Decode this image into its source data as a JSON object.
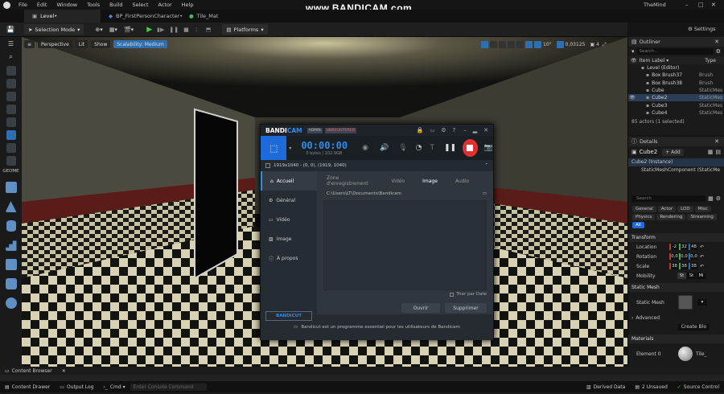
{
  "watermark": "www.BANDICAM.com",
  "menu": [
    "File",
    "Edit",
    "Window",
    "Tools",
    "Build",
    "Select",
    "Actor",
    "Help"
  ],
  "project_name": "TheMind",
  "tabs": [
    {
      "label": "Level•",
      "active": true
    },
    {
      "label": "BP_FirstPersonCharacter•",
      "active": false
    },
    {
      "label": "Tile_Mat",
      "active": false
    }
  ],
  "toolbar": {
    "selection_mode": "Selection Mode",
    "platforms": "Platforms",
    "settings": "Settings",
    "snap_angle": "10°",
    "snap_scale": "0,03125",
    "cam_speed": "4"
  },
  "viewport_bar": {
    "perspective": "Perspective",
    "lit": "Lit",
    "show": "Show",
    "scalability": "Scalability: Medium"
  },
  "left_panel": {
    "geometry_label": "GEOME"
  },
  "outliner": {
    "title": "Outliner",
    "search_placeholder": "Search...",
    "col_label": "Item Label ▾",
    "col_type": "Type",
    "rows": [
      {
        "label": "Level (Editor)",
        "type": "",
        "indent": 1,
        "selected": false
      },
      {
        "label": "Box Brush37",
        "type": "Brush",
        "indent": 2,
        "selected": false
      },
      {
        "label": "Box Brush38",
        "type": "Brush",
        "indent": 2,
        "selected": false
      },
      {
        "label": "Cube",
        "type": "StaticMes",
        "indent": 2,
        "selected": false
      },
      {
        "label": "Cube2",
        "type": "StaticMes",
        "indent": 2,
        "selected": true
      },
      {
        "label": "Cube3",
        "type": "StaticMes",
        "indent": 2,
        "selected": false
      },
      {
        "label": "Cube4",
        "type": "StaticMes",
        "indent": 2,
        "selected": false
      }
    ],
    "count": "85 actors (1 selected)"
  },
  "details": {
    "title": "Details",
    "actor_name": "Cube2",
    "add_label": "+ Add",
    "instance": "Cube2 (Instance)",
    "component": "StaticMeshComponent (StaticMe",
    "search_placeholder": "Search",
    "filters": [
      "General",
      "Actor",
      "LOD",
      "Misc",
      "Physics",
      "Rendering",
      "Streaming",
      "All"
    ],
    "transform_title": "Transform",
    "location_label": "Location",
    "location": [
      "-2",
      "32",
      "48"
    ],
    "rotation_label": "Rotation",
    "rotation": [
      "0,0",
      "0,0",
      "0,0"
    ],
    "scale_label": "Scale",
    "scale": [
      "38",
      "38",
      "38"
    ],
    "mobility_label": "Mobility",
    "mobility_opts": [
      "St",
      "St",
      "Mi"
    ],
    "static_mesh_title": "Static Mesh",
    "static_mesh_label": "Static Mesh",
    "advanced_label": "Advanced",
    "create_bp": "Create Blo",
    "materials_title": "Materials",
    "element_label": "Element 0",
    "material_name": "Tile_"
  },
  "bottom": {
    "content_browser_tab": "Content Browser",
    "content_drawer": "Content Drawer",
    "output_log": "Output Log",
    "cmd": "Cmd",
    "console_placeholder": "Enter Console Command",
    "derived_data": "Derived Data",
    "unsaved": "2 Unsaved",
    "source_control": "Source Control"
  },
  "bandicam": {
    "logo_a": "BANDI",
    "logo_b": "CAM",
    "admin_badge": "ADMIN",
    "unregistered_badge": "UNREGISTERED",
    "timer": "00:00:00",
    "size": "0 bytes / 102.9GB",
    "resolution": "1919x1040 - (0, 0), (1919, 1040)",
    "nav": [
      "Accueil",
      "Général",
      "Vidéo",
      "Image",
      "À propos"
    ],
    "tabs": [
      "Zone d'enregistrement",
      "Vidéo",
      "Image",
      "Audio"
    ],
    "path": "C:\\Users\\LT\\Documents\\Bandicam",
    "sort_label": "Trier par Date",
    "bandicut": "BANDICUT",
    "open_button": "Ouvrir",
    "delete_button": "Supprimer",
    "footer": "Bandicut est un programme essentiel pour les utilisateurs de Bandicam"
  },
  "colors": {
    "accent": "#1d6ad8",
    "rec": "#e03131",
    "bandicam_blue": "#2f8ce8",
    "scalability": "#2e6fb0"
  }
}
